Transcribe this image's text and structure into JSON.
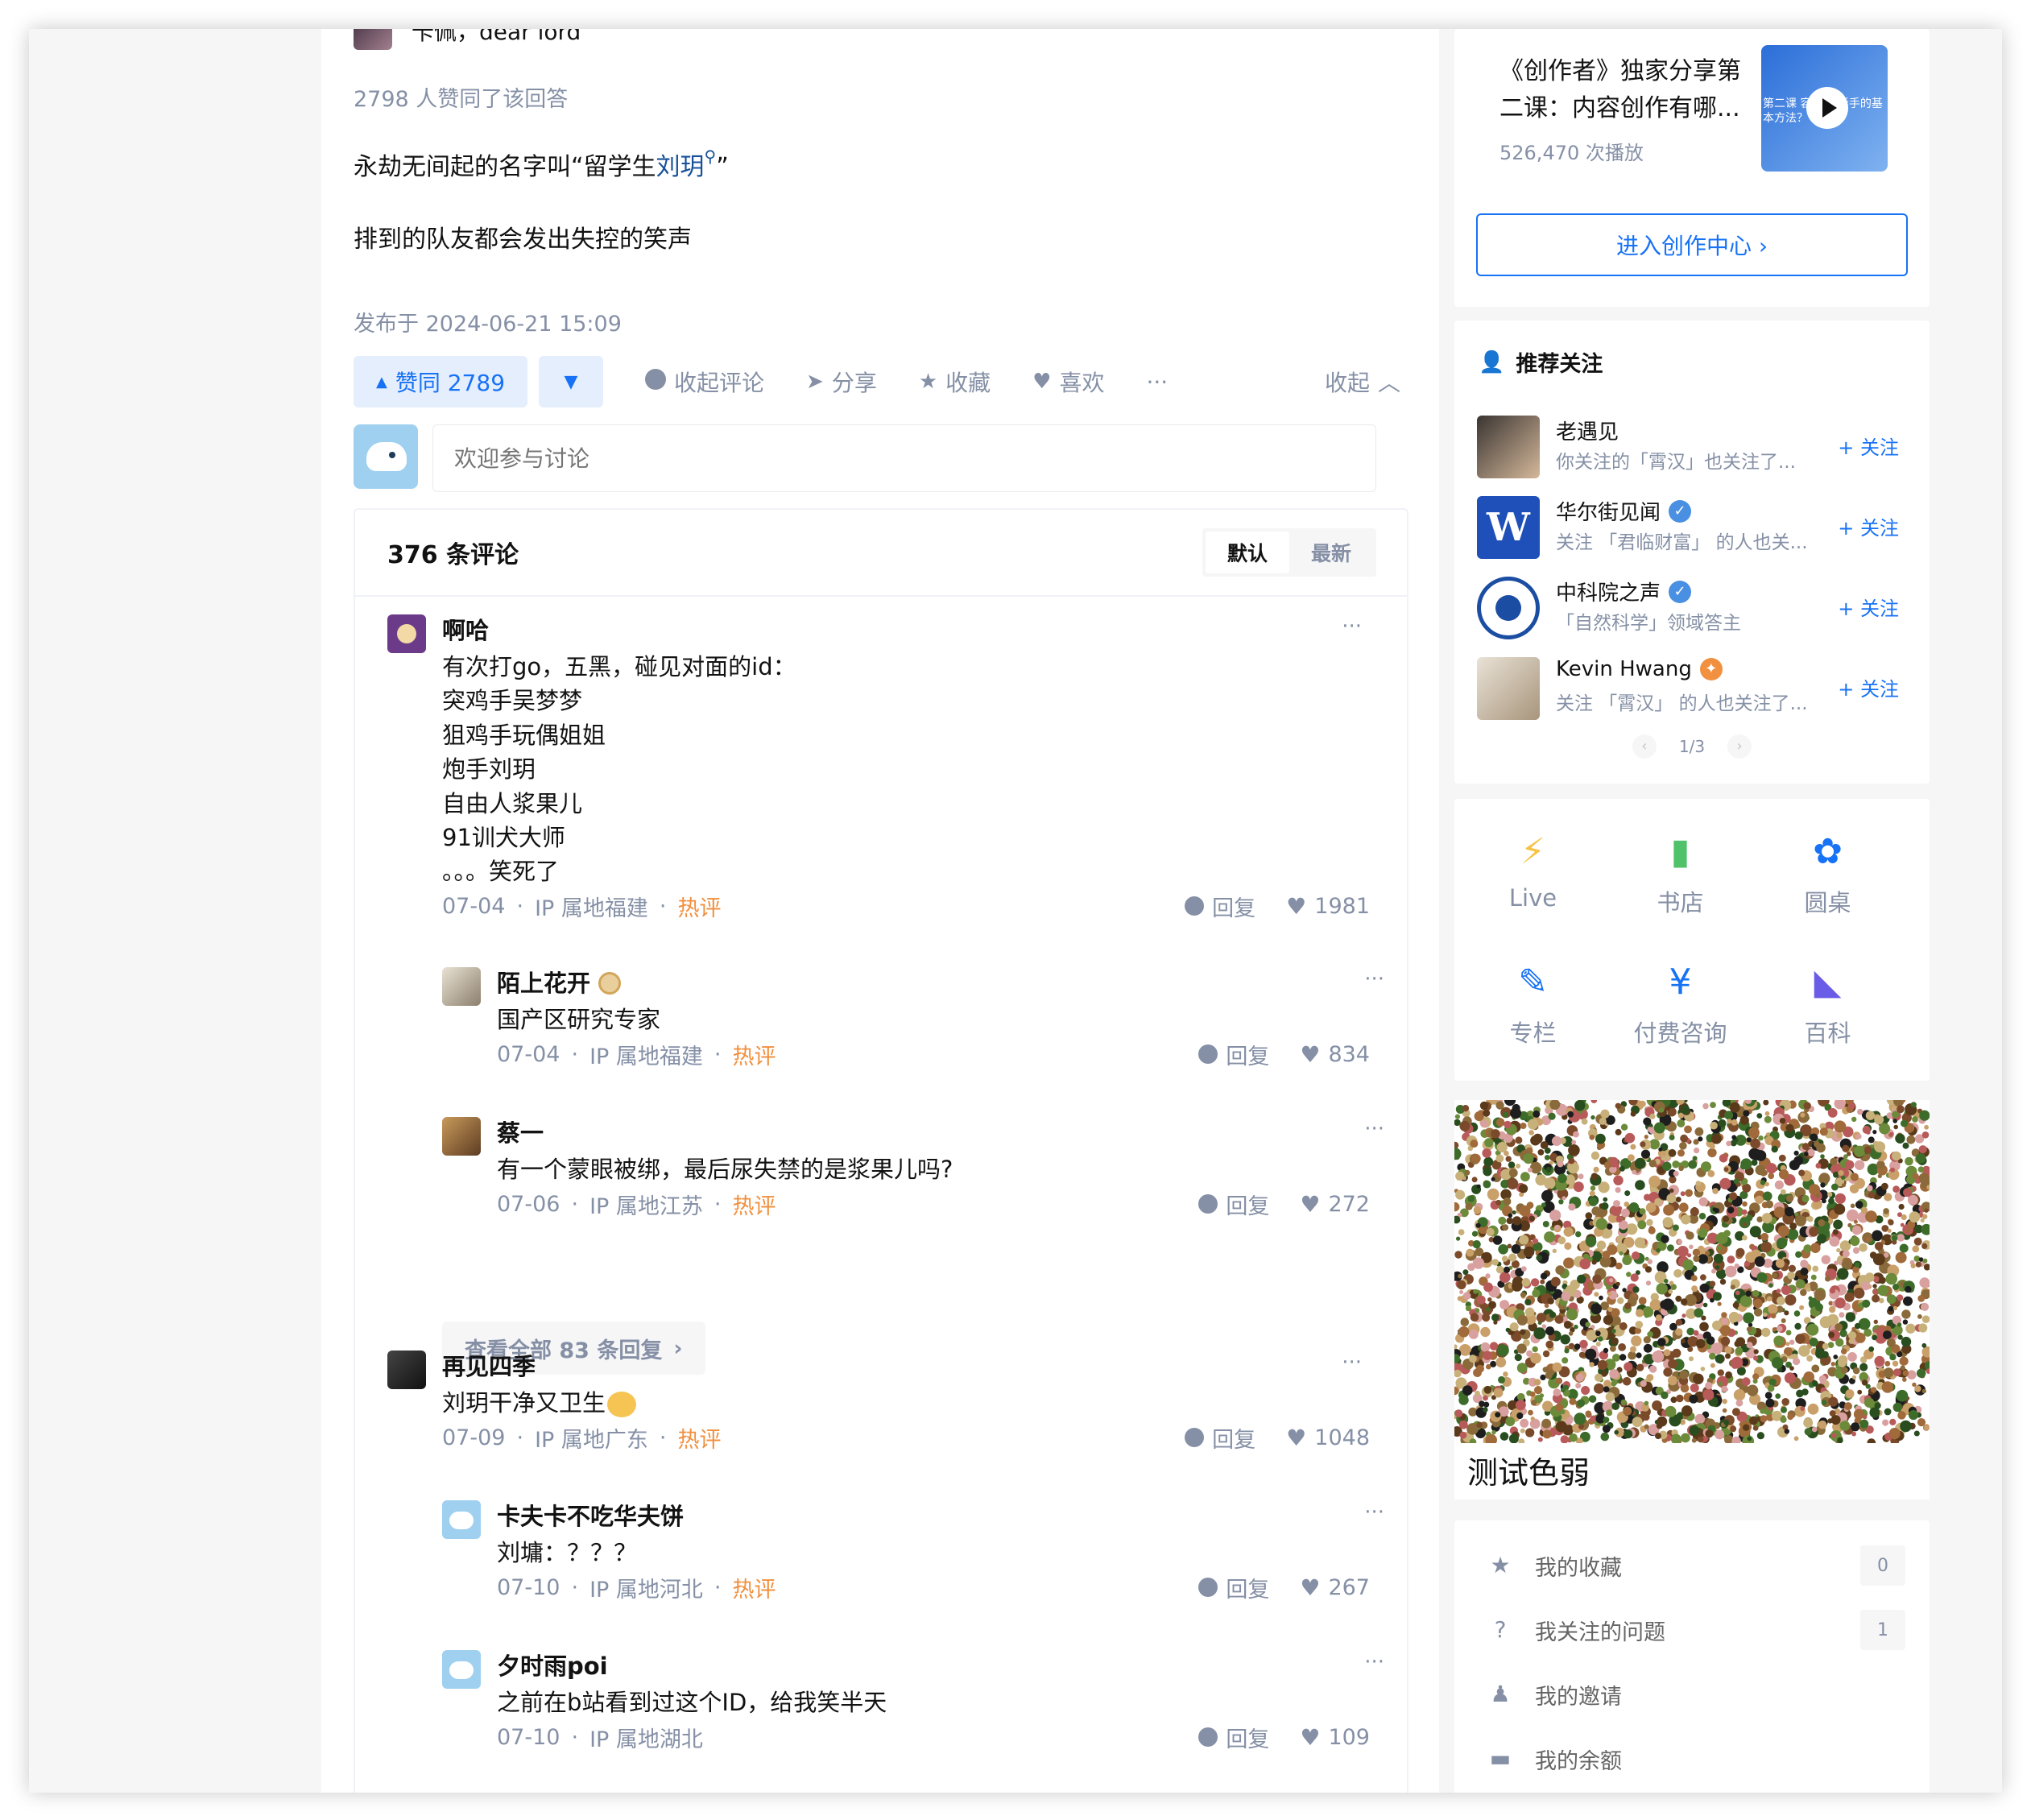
{
  "answer": {
    "author_name": "卡佩，dear lord",
    "vote_text": "2798 人赞同了该回答",
    "para1_before": "永劫无间起的名字叫“留学生",
    "para1_link": "刘玥",
    "para1_after": "”",
    "para2": "排到的队友都会发出失控的笑声",
    "published": "发布于 2024-06-21 15:09",
    "actions": {
      "upvote": "赞同 2789",
      "collapse_comments": "收起评论",
      "share": "分享",
      "collect": "收藏",
      "like": "喜欢",
      "more": "···",
      "collapse": "收起"
    },
    "comment_placeholder": "欢迎参与讨论"
  },
  "comments": {
    "count": "376 条评论",
    "sort_default": "默认",
    "sort_latest": "最新",
    "reply_label": "回复",
    "hot_label": "热评",
    "view_more": "查看全部 83 条回复",
    "items": [
      {
        "name": "啊哈",
        "text": "有次打go，五黑，碰见对面的id：\n突鸡手吴梦梦\n狙鸡手玩偶姐姐\n炮手刘玥\n自由人浆果儿\n91训犬大师\n。。。笑死了",
        "date": "07-04",
        "ip": "IP 属地福建",
        "likes": "1981",
        "hot": true
      },
      {
        "name": "陌上花开",
        "text": "国产区研究专家",
        "date": "07-04",
        "ip": "IP 属地福建",
        "likes": "834",
        "hot": true
      },
      {
        "name": "蔡一",
        "text": "有一个蒙眼被绑，最后尿失禁的是浆果儿吗?",
        "date": "07-06",
        "ip": "IP 属地江苏",
        "likes": "272",
        "hot": true
      },
      {
        "name": "再见四季",
        "text": "刘玥干净又卫生",
        "date": "07-09",
        "ip": "IP 属地广东",
        "likes": "1048",
        "hot": true
      },
      {
        "name": "卡夫卡不吃华夫饼",
        "text": "刘墉：？？？",
        "date": "07-10",
        "ip": "IP 属地河北",
        "likes": "267",
        "hot": true
      },
      {
        "name": "夕时雨poi",
        "text": "之前在b站看到过这个ID，给我笑半天",
        "date": "07-10",
        "ip": "IP 属地湖北",
        "likes": "109",
        "hot": false
      }
    ]
  },
  "sidebar": {
    "creator": {
      "title": "《创作者》独家分享第二课：内容创作有哪...",
      "plays": "526,470 次播放",
      "thumb_caption": "第二课 容创作 新手的基本方法？",
      "button": "进入创作中心 ›"
    },
    "recommend": {
      "heading": "推荐关注",
      "follow_label": "+ 关注",
      "pager": "1/3",
      "users": [
        {
          "name": "老遇见",
          "desc": "你关注的「霄汉」也关注了...",
          "badge": ""
        },
        {
          "name": "华尔街见闻",
          "desc": "关注 「君临财富」 的人也关...",
          "badge": "verified"
        },
        {
          "name": "中科院之声",
          "desc": "「自然科学」领域答主",
          "badge": "verified"
        },
        {
          "name": "Kevin Hwang",
          "desc": "关注 「霄汉」 的人也关注了...",
          "badge": "orange"
        }
      ]
    },
    "entries": [
      {
        "label": "Live",
        "icon": "lightning-icon",
        "color": "#f6c344"
      },
      {
        "label": "书店",
        "icon": "book-icon",
        "color": "#4fc26a"
      },
      {
        "label": "圆桌",
        "icon": "flower-icon",
        "color": "#1772f6"
      },
      {
        "label": "专栏",
        "icon": "pen-icon",
        "color": "#1772f6"
      },
      {
        "label": "付费咨询",
        "icon": "yen-bubble-icon",
        "color": "#1772f6"
      },
      {
        "label": "百科",
        "icon": "folder-icon",
        "color": "#6b5ce7"
      }
    ],
    "ad_caption": "测试色弱",
    "my": [
      {
        "label": "我的收藏",
        "count": "0"
      },
      {
        "label": "我关注的问题",
        "count": "1"
      },
      {
        "label": "我的邀请",
        "count": ""
      },
      {
        "label": "我的余额",
        "count": ""
      }
    ]
  }
}
